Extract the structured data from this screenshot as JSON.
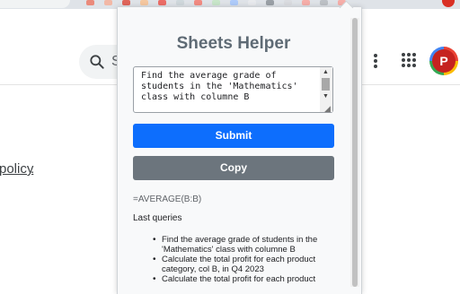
{
  "page": {
    "search_placeholder": "S",
    "policy_link": "policy",
    "policy_suffix": ".",
    "avatar_letter": "P"
  },
  "popup": {
    "title": "Sheets Helper",
    "query_value": "Find the average grade of\nstudents in the 'Mathematics'\nclass with columne B",
    "submit_label": "Submit",
    "copy_label": "Copy",
    "formula_result": "=AVERAGE(B:B)",
    "last_queries_heading": "Last queries",
    "last_queries": [
      "Find the average grade of students in the 'Mathematics' class with columne B",
      "Calculate the total profit for each product category, col B, in Q4 2023",
      "Calculate the total profit for each product"
    ]
  },
  "colors": {
    "submit": "#0d6efd",
    "copy": "#6c757d",
    "title": "#5f6b75"
  }
}
